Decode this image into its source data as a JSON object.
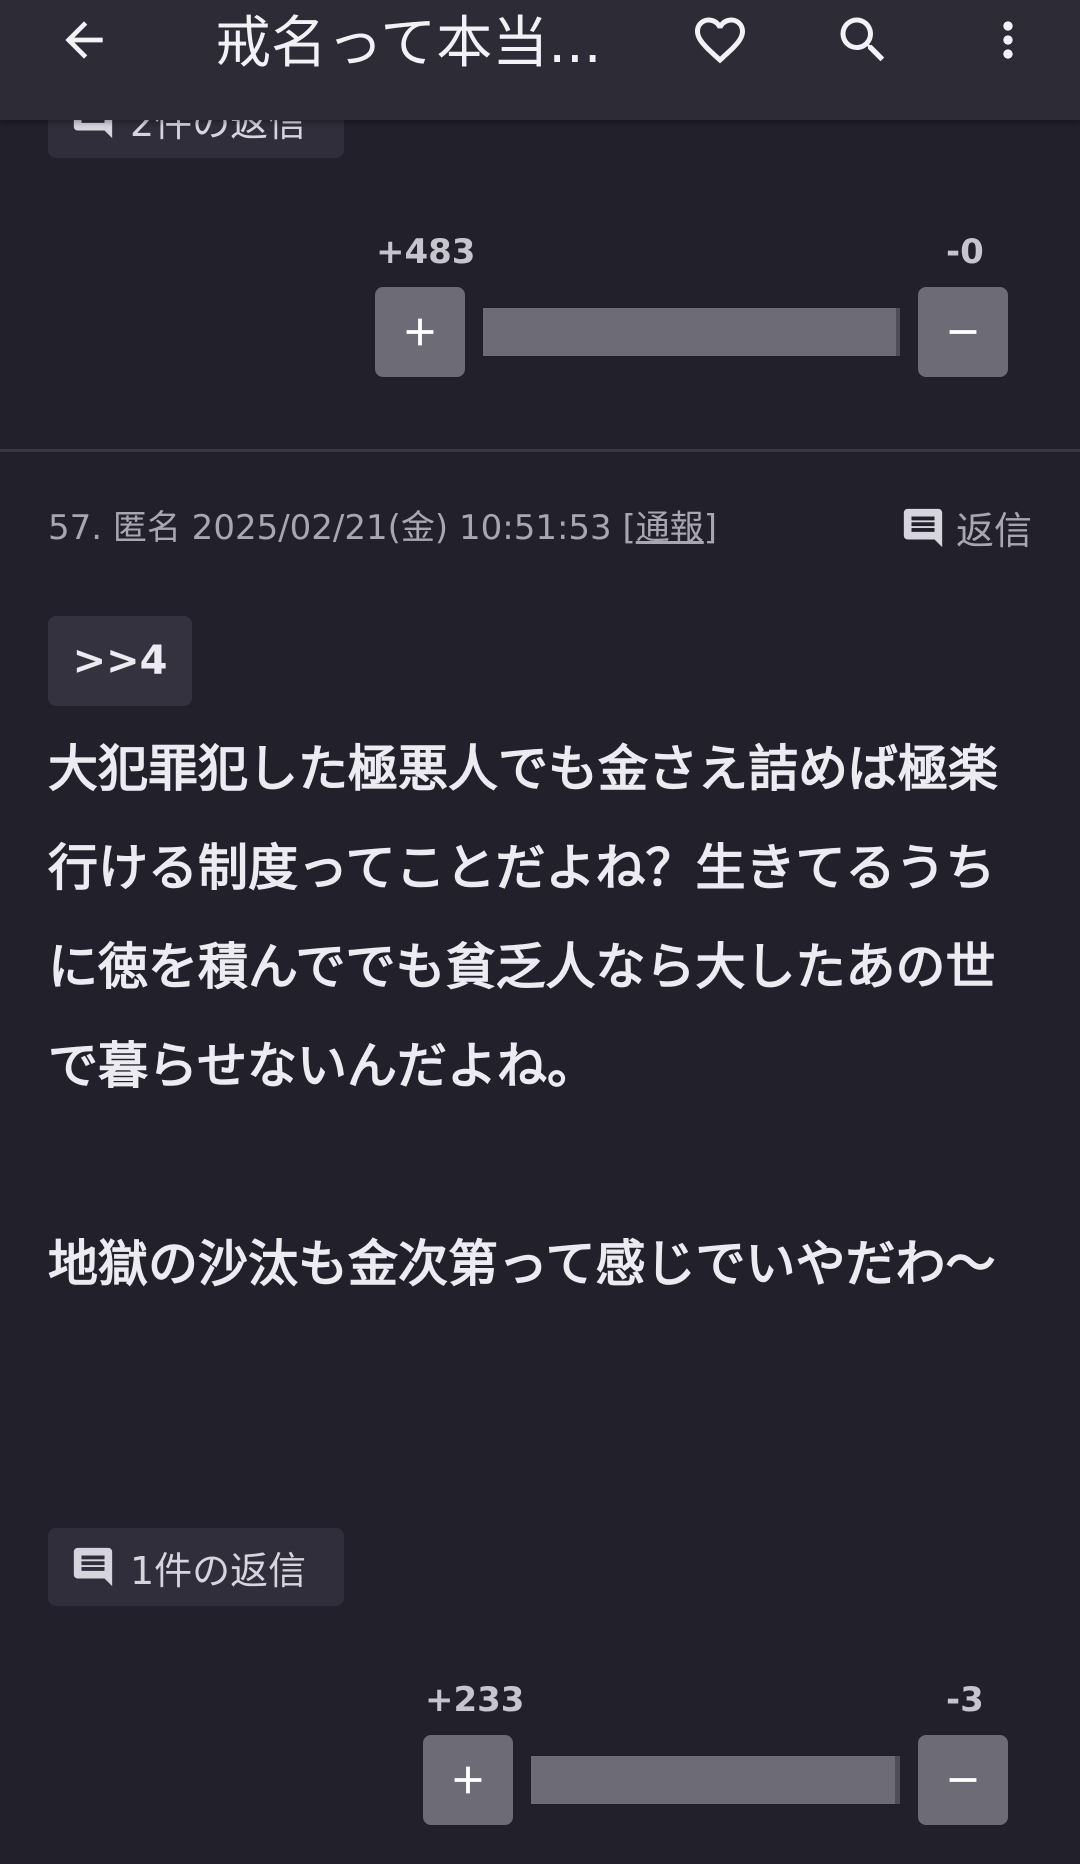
{
  "appbar": {
    "title": "戒名って本当...",
    "back_icon": "arrow-left-icon",
    "favorite_icon": "heart-outline-icon",
    "search_icon": "search-icon",
    "menu_icon": "more-vert-icon"
  },
  "prev_post": {
    "replies_label": "2件の返信",
    "votes": {
      "plus": "+483",
      "minus": "-0",
      "ratio": 0.99
    }
  },
  "post": {
    "meta_prefix": "57. 匿名 2025/02/21(金) 10:51:53 [",
    "report_label": "通報",
    "meta_suffix": "]",
    "reply_label": "返信",
    "anchor": ">>4",
    "body": "大犯罪犯した極悪人でも金さえ詰めば極楽行ける制度ってことだよね？生きてるうちに徳を積んででも貧乏人なら大したあの世で暮らせないんだよね。\n\n地獄の沙汰も金次第って感じでいやだわ〜",
    "replies_label": "1件の返信",
    "votes": {
      "plus": "+233",
      "minus": "-3",
      "ratio": 0.987
    }
  },
  "colors": {
    "background": "#21202b",
    "appbar": "#2c2b36",
    "vote_button": "#6d6c76",
    "text": "#ecebf1",
    "muted": "#a8a7b1"
  }
}
